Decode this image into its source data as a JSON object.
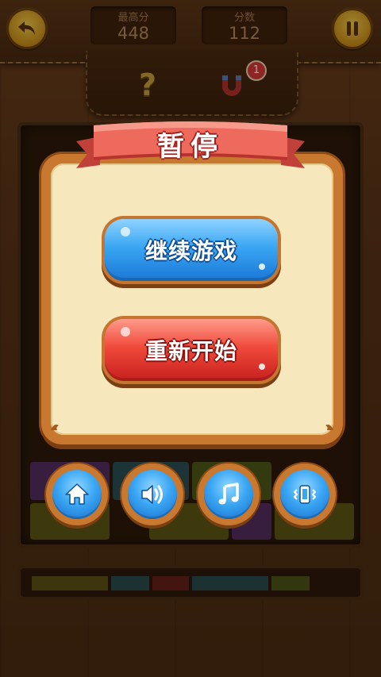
{
  "header": {
    "best_score_label": "最高分",
    "best_score_value": "448",
    "score_label": "分数",
    "score_value": "112",
    "back_icon": "back-arrow-icon",
    "pause_icon": "pause-icon"
  },
  "tools": {
    "hint_glyph": "?",
    "magnet_icon": "magnet-icon",
    "magnet_count": "1"
  },
  "dialog": {
    "title": "暂停",
    "continue_label": "继续游戏",
    "restart_label": "重新开始"
  },
  "options": [
    {
      "icon": "home-icon"
    },
    {
      "icon": "sound-icon"
    },
    {
      "icon": "music-icon"
    },
    {
      "icon": "vibrate-icon"
    }
  ],
  "colors": {
    "accent_blue": "#3aa6f3",
    "accent_red": "#ef4a3c",
    "frame_orange": "#c9782f",
    "panel_cream": "#f7e7bd"
  }
}
